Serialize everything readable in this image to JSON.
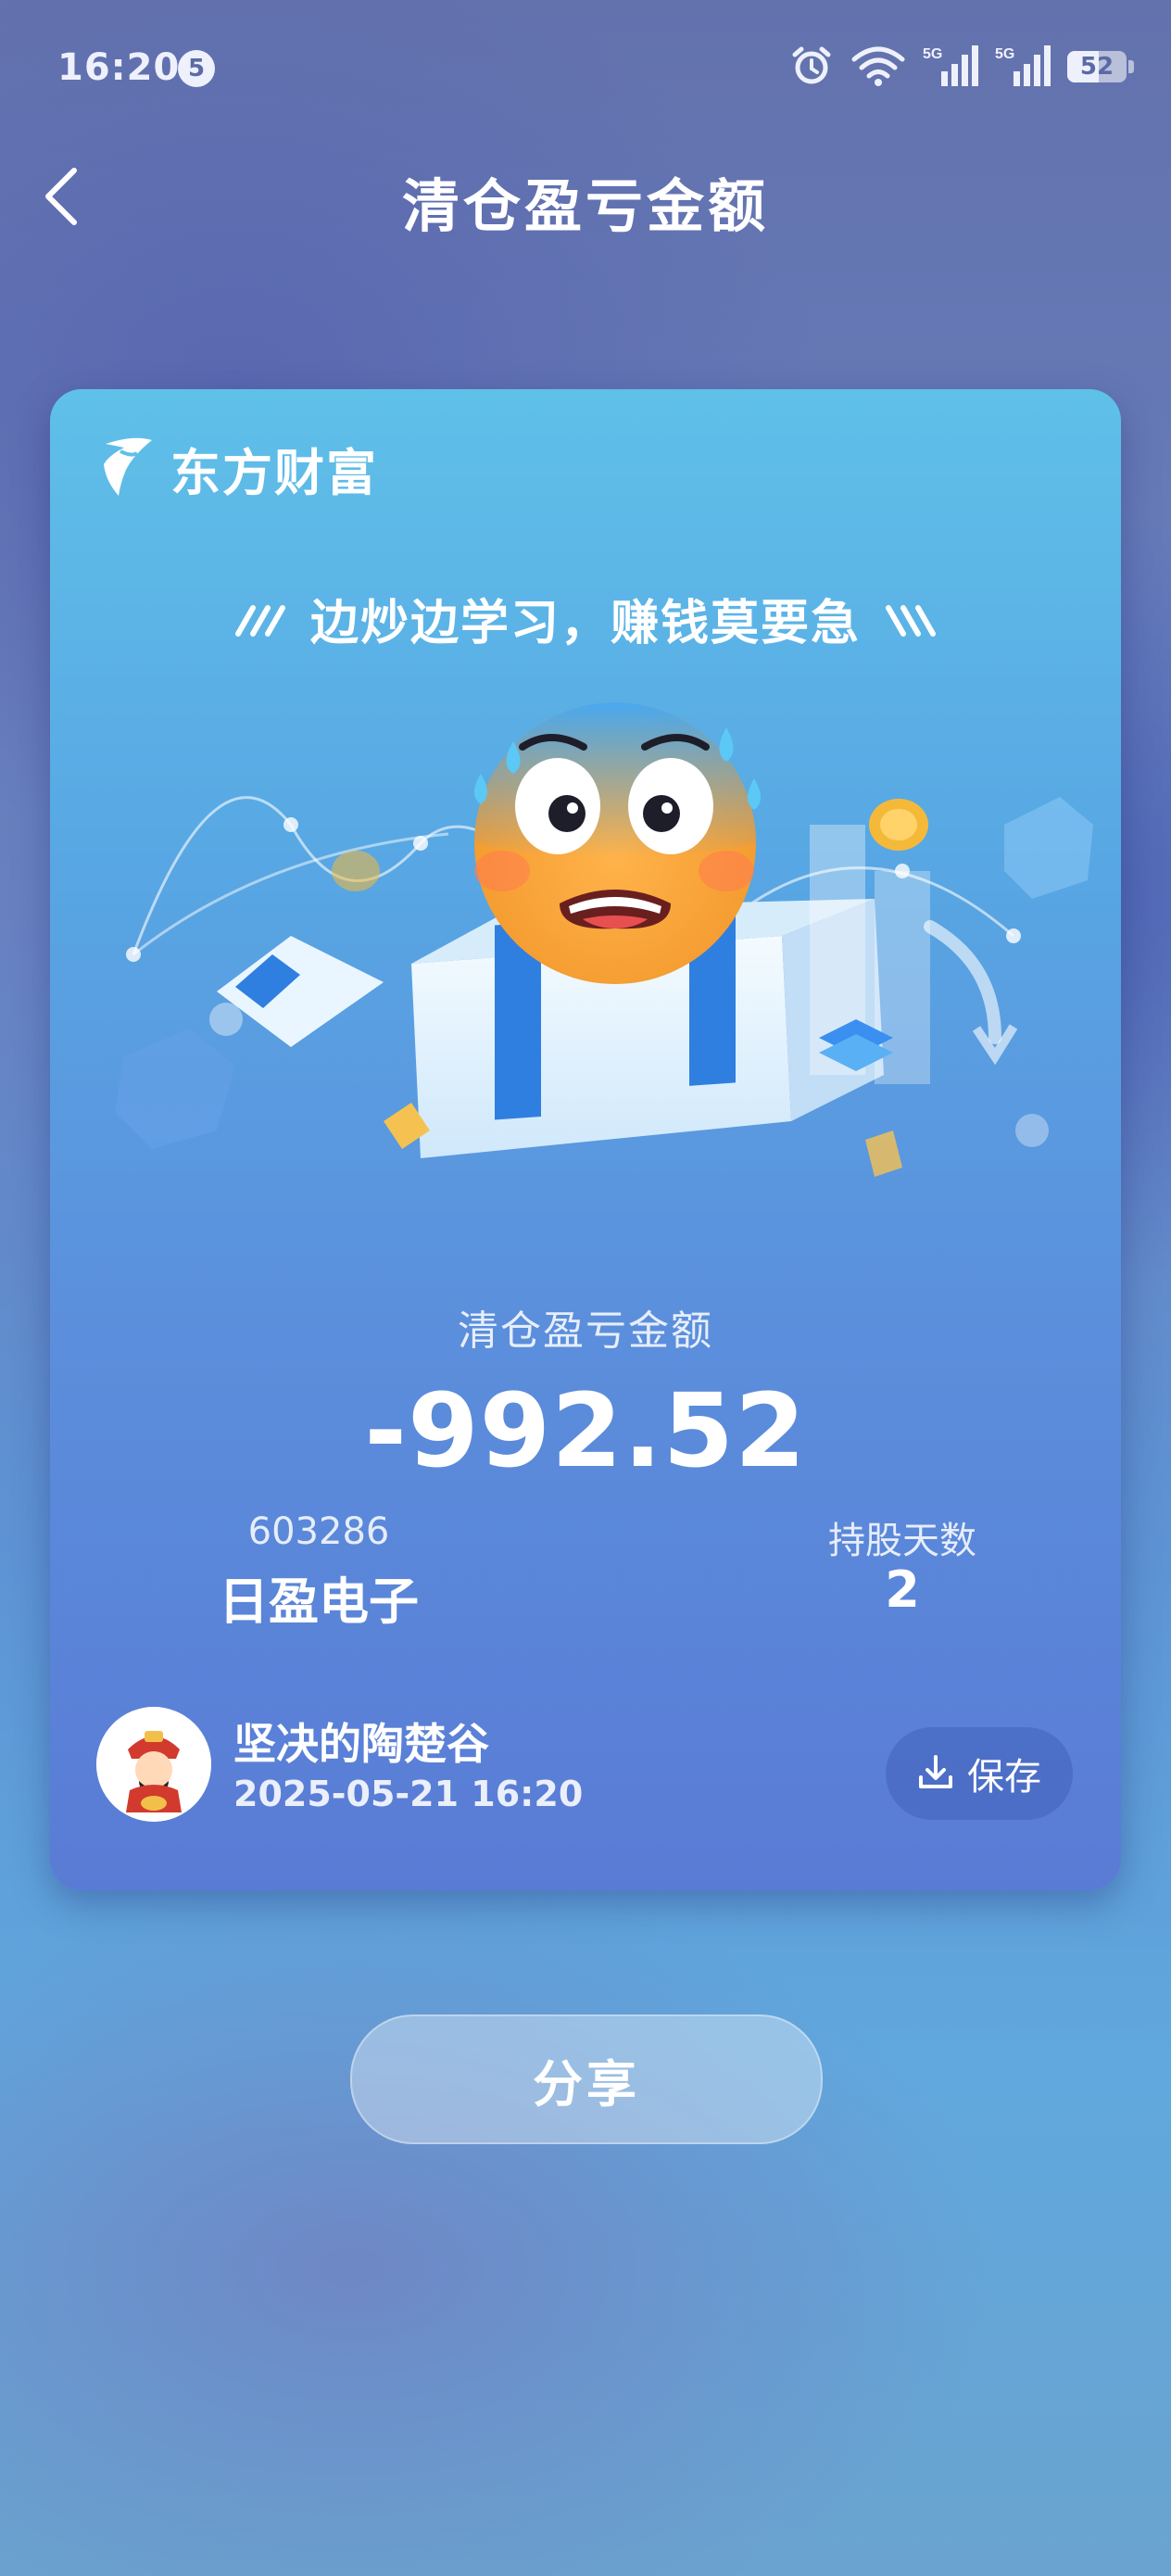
{
  "status_bar": {
    "time": "16:20",
    "notification_count": "5",
    "network_1": "5G",
    "network_2": "5G",
    "battery": "52"
  },
  "header": {
    "title": "清仓盈亏金额"
  },
  "card": {
    "brand": "东方财富",
    "slogan": "边炒边学习，赚钱莫要急",
    "label": "清仓盈亏金额",
    "amount": "-992.52",
    "stock_code": "603286",
    "stock_name": "日盈电子",
    "days_label": "持股天数",
    "days_value": "2",
    "user_name": "坚决的陶楚谷",
    "timestamp": "2025-05-21 16:20",
    "save_label": "保存"
  },
  "share": {
    "label": "分享"
  },
  "colors": {
    "card_top": "#5fc0e8",
    "card_bottom": "#5a7bd5",
    "emoji_face": "#f7a23a",
    "emoji_top": "#4aa8ef"
  },
  "icons": {
    "alarm": "alarm-icon",
    "wifi": "wifi-icon",
    "signal": "signal-icon",
    "back": "chevron-left-icon",
    "download": "download-icon",
    "brand_logo": "eastmoney-logo"
  }
}
